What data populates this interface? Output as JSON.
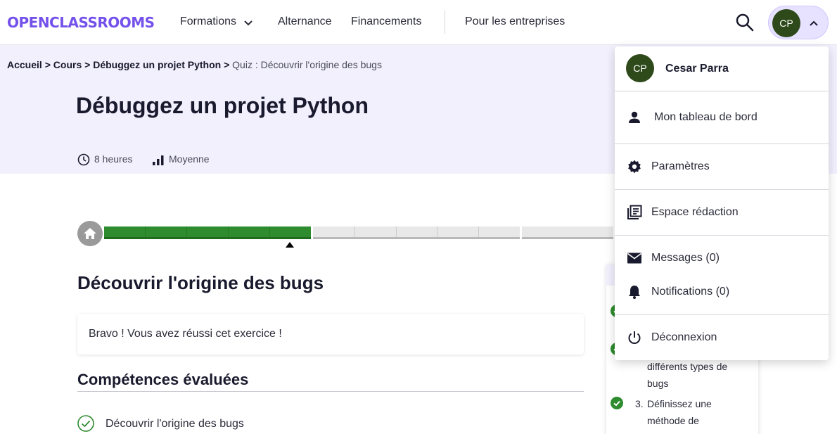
{
  "header": {
    "logo": "OPENCLASSROOMS",
    "nav": {
      "formations": "Formations",
      "alternance": "Alternance",
      "financements": "Financements",
      "entreprises": "Pour les entreprises"
    },
    "user_initials": "CP"
  },
  "breadcrumb": {
    "home": "Accueil",
    "courses": "Cours",
    "course": "Débuggez un projet Python",
    "sep": ">",
    "current": "Quiz : Découvrir l'origine des bugs"
  },
  "course": {
    "title": "Débuggez un projet Python",
    "duration": "8 heures",
    "level": "Moyenne"
  },
  "progress": {
    "completed_segments": 5,
    "segment_count": 15
  },
  "quiz": {
    "title": "Découvrir l'origine des bugs",
    "success_message": "Bravo ! Vous avez réussi cet exercice !",
    "skills_heading": "Compétences évaluées",
    "skills": [
      "Découvrir l'origine des bugs"
    ]
  },
  "sidebar": {
    "item2_line2": "différents types de",
    "item2_line3": "bugs",
    "item3_num": "3.",
    "item3_line1": "Définissez une",
    "item3_line2": "méthode de"
  },
  "user_menu": {
    "initials": "CP",
    "name": "Cesar Parra",
    "dashboard": "Mon tableau de bord",
    "settings": "Paramètres",
    "writing_space": "Espace rédaction",
    "messages": "Messages (0)",
    "notifications": "Notifications (0)",
    "logout": "Déconnexion"
  },
  "colors": {
    "brand": "#7451eb",
    "hero_bg": "#f2f0fd",
    "progress_done": "#2e8b2e",
    "avatar": "#2e4a1b"
  }
}
